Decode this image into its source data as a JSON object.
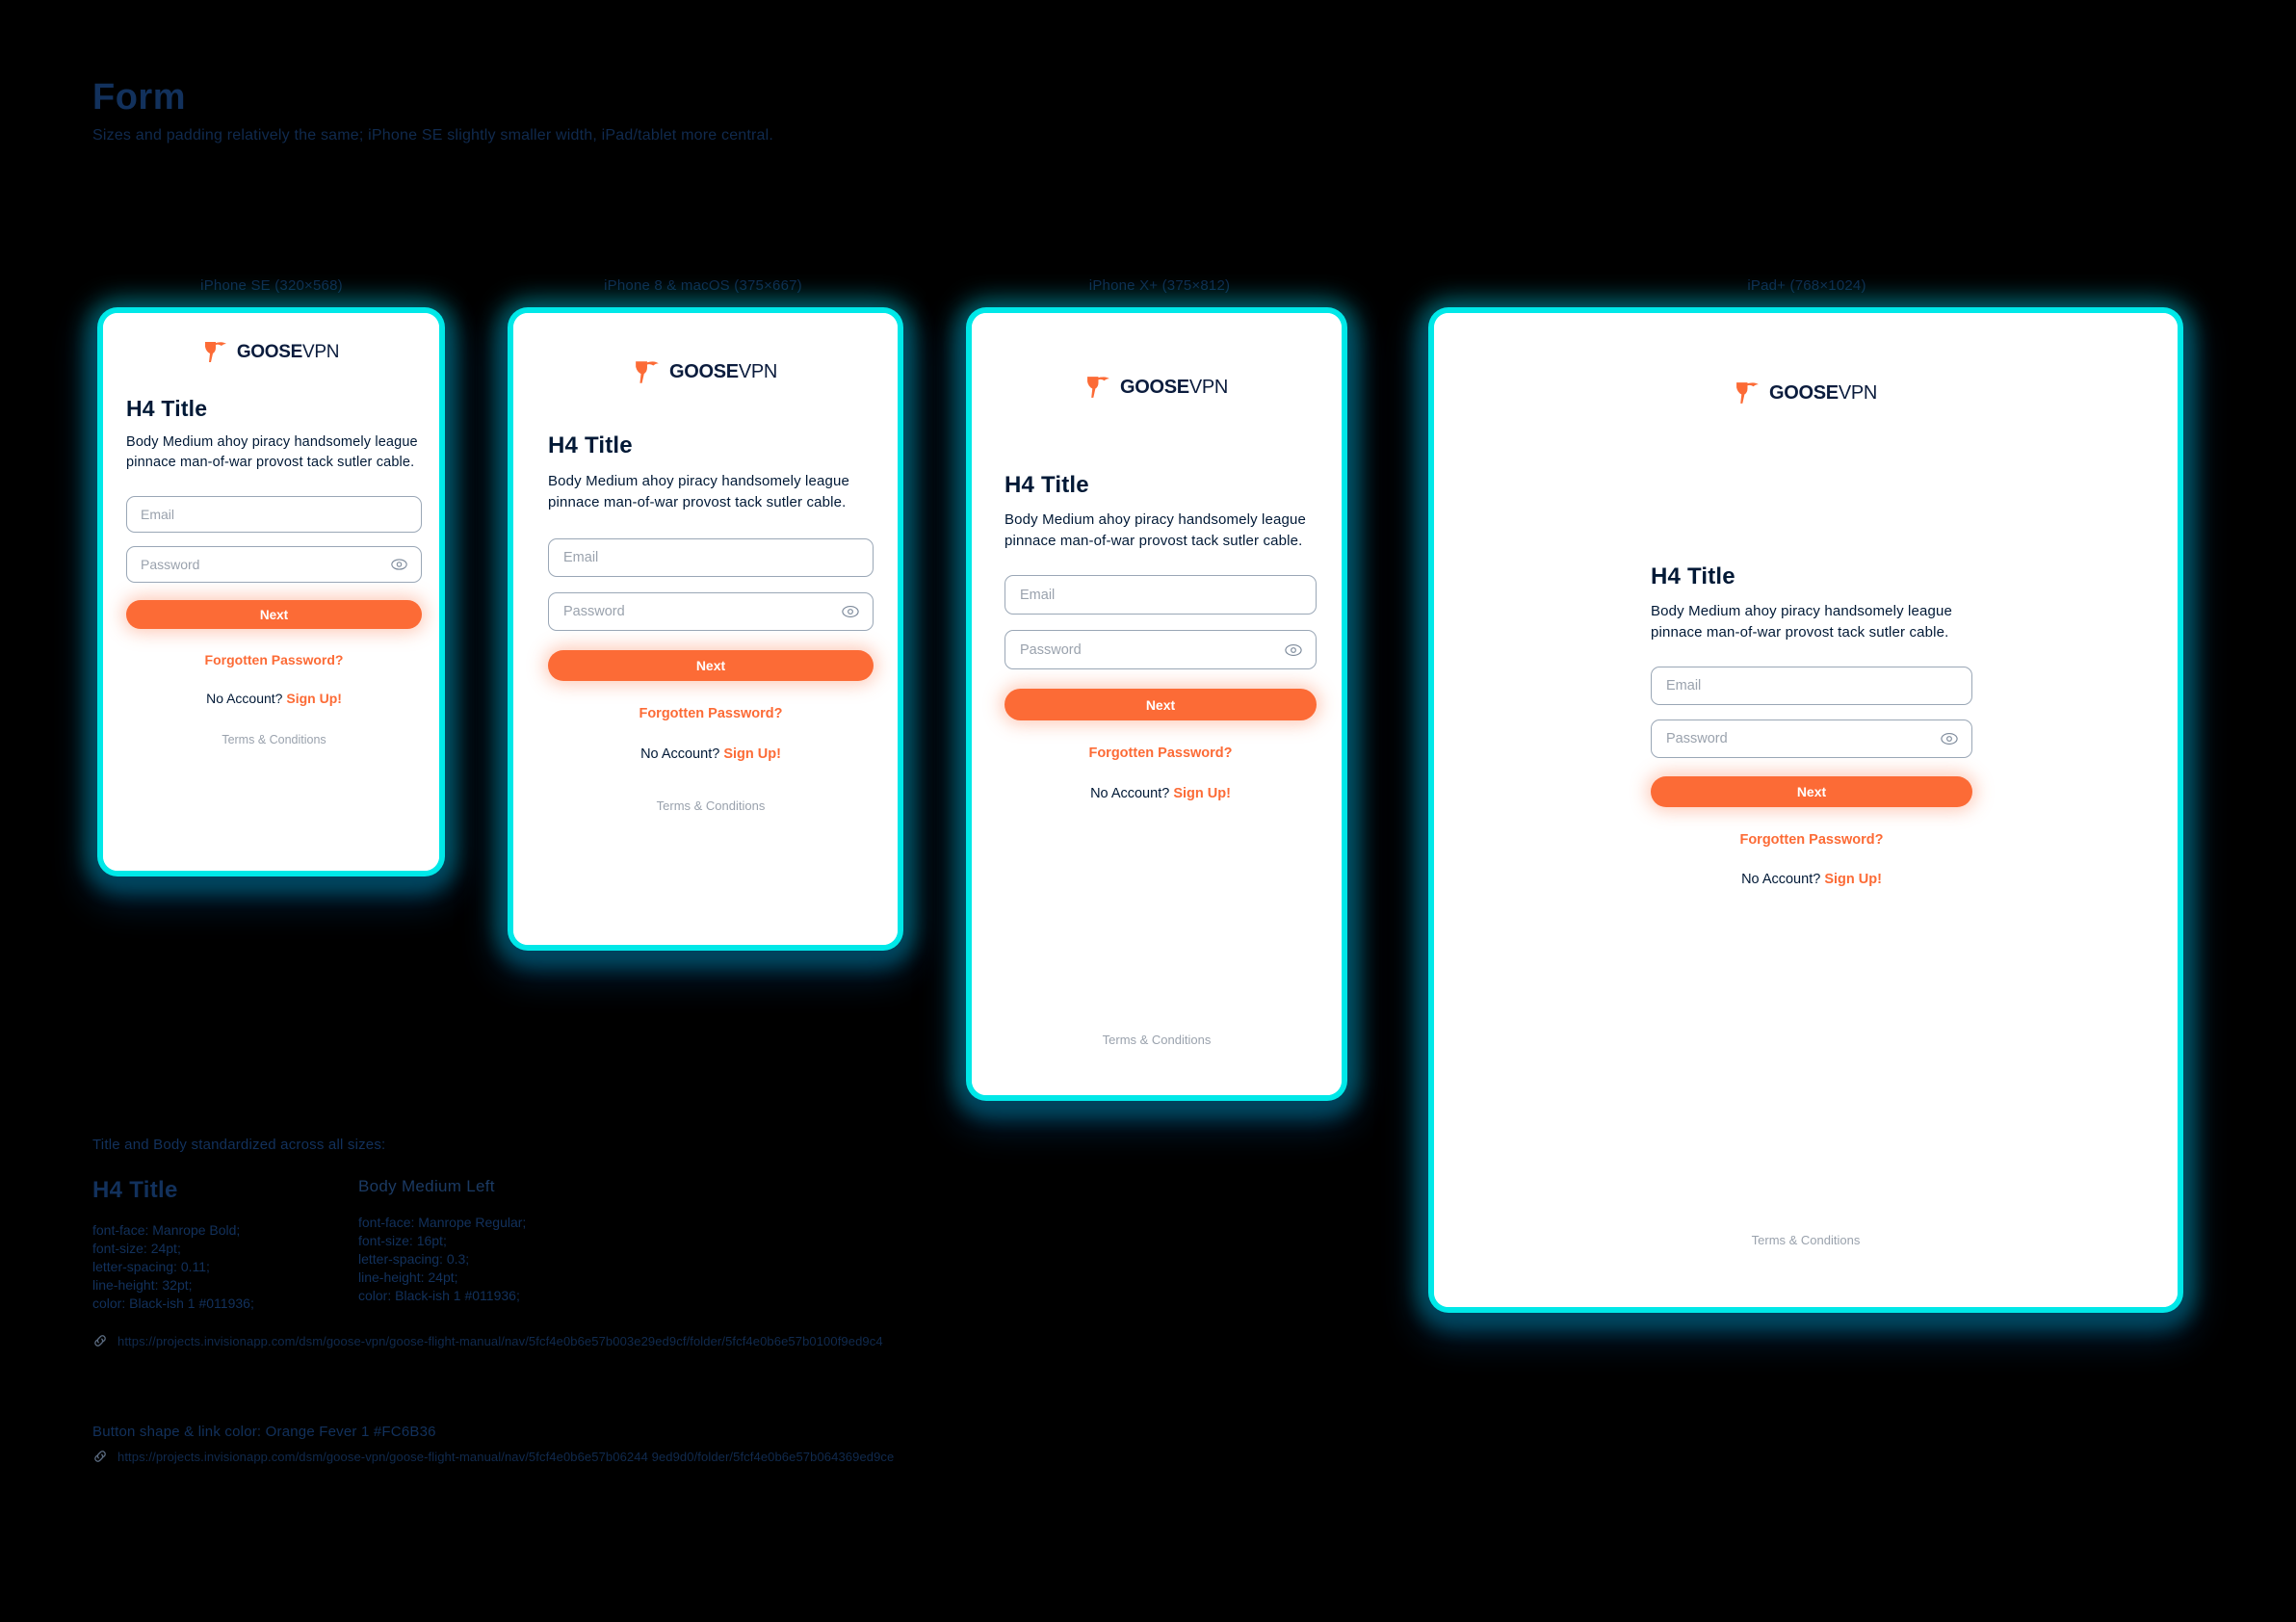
{
  "header": {
    "title": "Form",
    "subtitle": "Sizes and padding relatively the same; iPhone SE slightly smaller width, iPad/tablet more central."
  },
  "brand": {
    "word_bold": "GOOSE",
    "word_light": "VPN",
    "logo_icon": "goose-icon",
    "orange": "#FC6B36",
    "navy": "#011936",
    "cyan": "#00E8E8"
  },
  "devices": [
    {
      "label": "iPhone SE (320×568)"
    },
    {
      "label": "iPhone 8 & macOS (375×667)"
    },
    {
      "label": "iPhone X+ (375×812)"
    },
    {
      "label": "iPad+ (768×1024)"
    }
  ],
  "form": {
    "title": "H4 Title",
    "body": "Body Medium ahoy piracy handsomely league pinnace man-of-war provost tack sutler cable.",
    "email_placeholder": "Email",
    "password_placeholder": "Password",
    "password_toggle_icon": "eye-icon",
    "next_label": "Next",
    "forgotten_label": "Forgotten Password?",
    "no_account_text": "No Account?",
    "sign_up_label": "Sign Up!",
    "terms_label": "Terms & Conditions"
  },
  "specs": {
    "heading": "Title and Body standardized across all sizes:",
    "col1": {
      "sample": "H4 Title",
      "lines": "font-face: Manrope Bold;\nfont-size: 24pt;\nletter-spacing: 0.11;\nline-height: 32pt;\ncolor: Black-ish 1 #011936;"
    },
    "col2": {
      "sample": "Body Medium Left",
      "lines": "font-face: Manrope Regular;\nfont-size: 16pt;\nletter-spacing: 0.3;\nline-height: 24pt;\ncolor: Black-ish 1 #011936;"
    }
  },
  "links": {
    "link1_icon": "chain-link-icon",
    "link1_url": "https://projects.invisionapp.com/dsm/goose-vpn/goose-flight-manual/nav/5fcf4e0b6e57b003e29ed9cf/folder/5fcf4e0b6e57b0100f9ed9c4",
    "button_note": "Button shape & link color: Orange Fever 1 #FC6B36",
    "link2_icon": "chain-link-icon",
    "link2_url": "https://projects.invisionapp.com/dsm/goose-vpn/goose-flight-manual/nav/5fcf4e0b6e57b06244 9ed9d0/folder/5fcf4e0b6e57b064369ed9ce"
  }
}
